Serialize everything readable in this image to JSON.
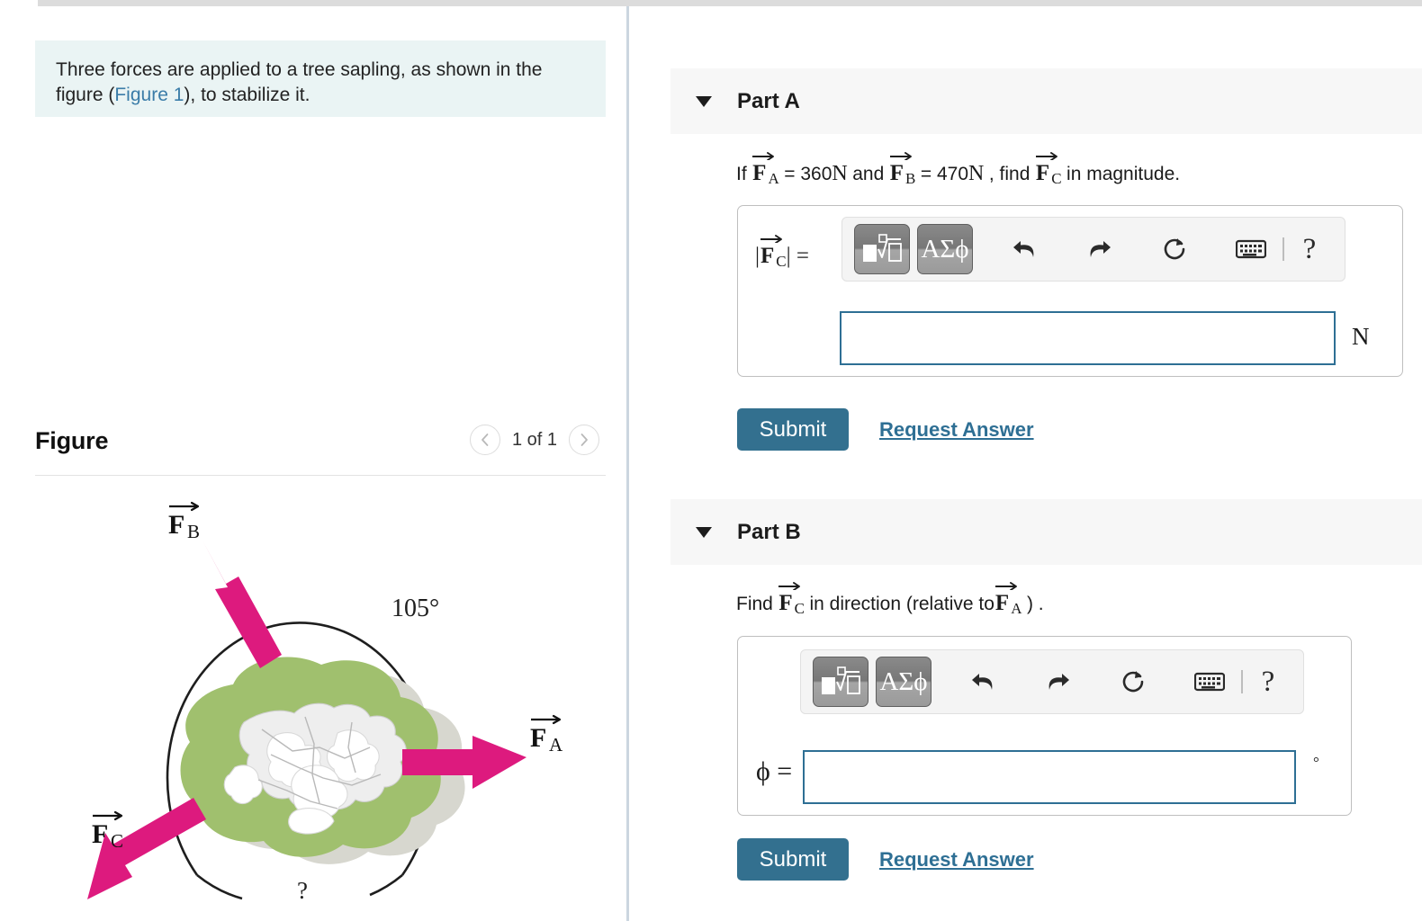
{
  "problem": {
    "statement_before_link": "Three forces are applied to a tree sapling, as shown in the figure (",
    "figure_link_text": "Figure 1",
    "statement_after_link": "), to stabilize it."
  },
  "figure_panel": {
    "title": "Figure",
    "pager": {
      "prev_icon": "chevron-left-icon",
      "next_icon": "chevron-right-icon",
      "count_text": "1 of 1"
    }
  },
  "figure": {
    "labels": {
      "fb": "F",
      "fb_sub": "B",
      "fa": "F",
      "fa_sub": "A",
      "fc": "F",
      "fc_sub": "C",
      "angle_known": "105°",
      "angle_unknown": "?"
    },
    "colors": {
      "arrow": "#DD1A7E",
      "canopy": "#A0C06E",
      "shadow": "#d6d6cf",
      "branch": "#e9e9e9",
      "arc": "#1e1e1e"
    }
  },
  "parts": [
    {
      "id": "part-a",
      "header_label": "Part A",
      "caret_icon": "caret-down-icon",
      "question": {
        "prefix": "If",
        "f_a": "F",
        "f_a_sub": "A",
        "eq1": "= 360",
        "unit1": "N",
        "and": "and",
        "f_b": "F",
        "f_b_sub": "B",
        "eq2": "= 470",
        "unit2": "N",
        "comma_find": ", find",
        "f_c": "F",
        "f_c_sub": "C",
        "suffix": "in magnitude."
      },
      "answer": {
        "label_open": "|",
        "label_f": "F",
        "label_sub": "C",
        "label_close": "| =",
        "value": "",
        "placeholder": "",
        "unit": "N"
      },
      "submit_label": "Submit",
      "request_answer_label": "Request Answer"
    },
    {
      "id": "part-b",
      "header_label": "Part B",
      "caret_icon": "caret-down-icon",
      "question": {
        "prefix": "Find",
        "f_c": "F",
        "f_c_sub": "C",
        "middle": "in direction (relative to",
        "f_a": "F",
        "f_a_sub": "A",
        "suffix": ") ."
      },
      "answer": {
        "label": "ϕ =",
        "value": "",
        "placeholder": "",
        "unit": "°"
      },
      "submit_label": "Submit",
      "request_answer_label": "Request Answer"
    }
  ],
  "math_toolbar": {
    "template_button": {
      "icon": "math-template-sqrt-icon",
      "title": "Math templates"
    },
    "greek_button": {
      "icon": "greek-letters-icon",
      "label": "ΑΣϕ",
      "title": "Greek letters"
    },
    "undo": {
      "icon": "undo-arrow-icon"
    },
    "redo": {
      "icon": "redo-arrow-icon"
    },
    "reset": {
      "icon": "reset-circular-arrow-icon"
    },
    "keyboard": {
      "icon": "keyboard-icon"
    },
    "help": {
      "icon": "help-question-icon",
      "label": "?"
    }
  },
  "theme": {
    "accent_blue": "#33708f",
    "link_blue": "#2e6f94",
    "intro_bg": "#eaf4f4",
    "header_bg": "#f7f7f7",
    "input_border": "#2e6f94"
  }
}
